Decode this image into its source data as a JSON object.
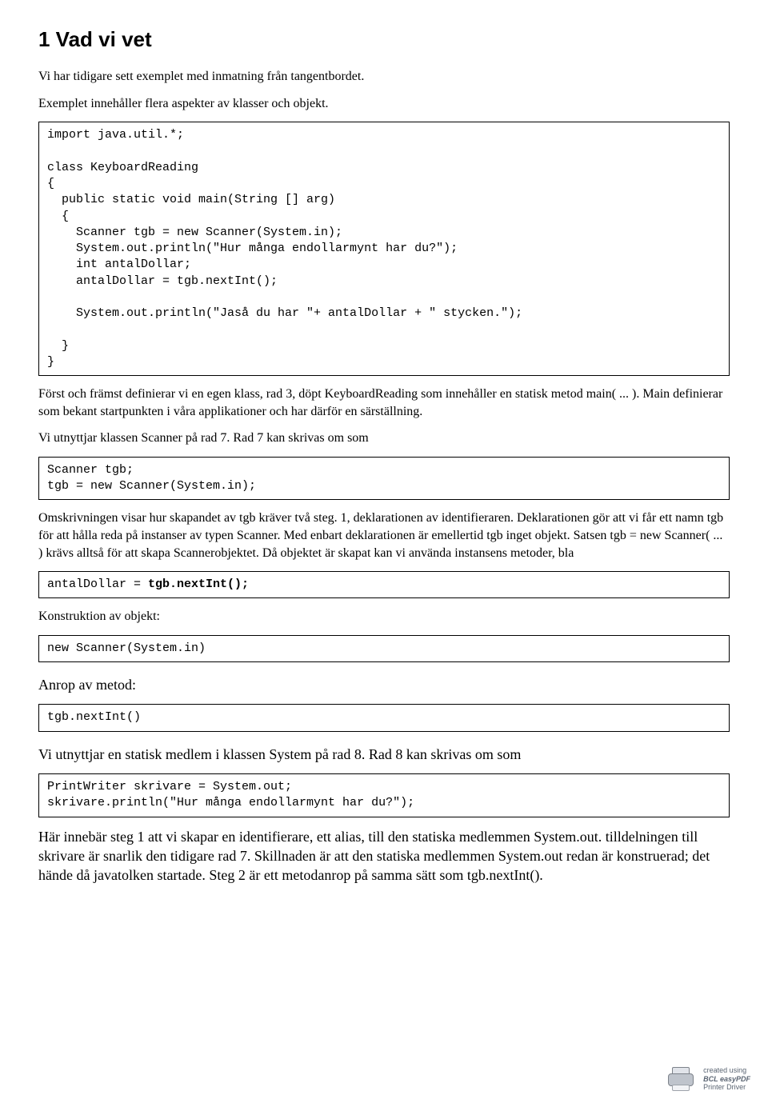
{
  "heading": "1  Vad vi vet",
  "intro1": "Vi har tidigare sett exemplet med inmatning från tangentbordet.",
  "intro2": "Exemplet innehåller flera aspekter av klasser och objekt.",
  "code1": "import java.util.*;\n\nclass KeyboardReading\n{\n  public static void main(String [] arg)\n  {\n    Scanner tgb = new Scanner(System.in);\n    System.out.println(\"Hur många endollarmynt har du?\");\n    int antalDollar;\n    antalDollar = tgb.nextInt();\n\n    System.out.println(\"Jaså du har \"+ antalDollar + \" stycken.\");\n\n  }\n}",
  "para3": "Först och främst definierar vi en egen klass, rad 3, döpt KeyboardReading som innehåller en statisk metod main( ... ). Main definierar som bekant startpunkten i våra applikationer och har därför en särställning.",
  "para4": "Vi utnyttjar klassen Scanner på rad 7. Rad 7 kan skrivas om som",
  "code2": "Scanner tgb;\ntgb = new Scanner(System.in);",
  "para5": "Omskrivningen visar hur skapandet av tgb kräver två steg. 1, deklarationen av identifieraren. Deklarationen gör att vi får ett namn tgb för att hålla reda på instanser av typen Scanner. Med enbart deklarationen är emellertid tgb inget objekt. Satsen tgb = new Scanner( ... ) krävs alltså för att skapa Scannerobjektet. Då objektet är skapat kan vi använda instansens metoder, bla",
  "code3_pre": "antalDollar = ",
  "code3_bold": "tgb.nextInt();",
  "para6": "Konstruktion av objekt:",
  "code4": "new Scanner(System.in)",
  "para7": "Anrop av metod:",
  "code5": "tgb.nextInt()",
  "para8": "Vi utnyttjar en statisk medlem i klassen System på rad 8. Rad 8 kan skrivas om som",
  "code6": "PrintWriter skrivare = System.out;\nskrivare.println(\"Hur många endollarmynt har du?\");",
  "para9": "Här innebär steg 1 att vi skapar en identifierare, ett alias, till den statiska medlemmen System.out. tilldelningen till skrivare är snarlik den tidigare rad 7. Skillnaden är att den statiska medlemmen System.out redan är konstruerad; det hände då javatolken startade. Steg 2 är ett metodanrop på samma sätt som tgb.nextInt().",
  "footer": {
    "line1": "created using",
    "line2": "BCL easyPDF",
    "line3": "Printer Driver"
  }
}
